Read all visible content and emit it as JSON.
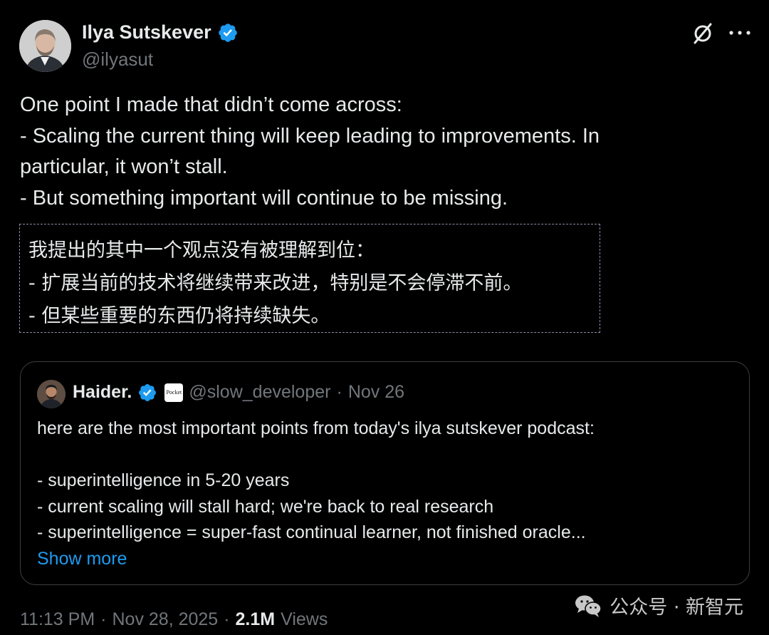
{
  "author": {
    "name": "Ilya Sutskever",
    "handle": "@ilyasut",
    "verified": true
  },
  "header_icons": {
    "grok": "grok-icon",
    "more": "more-options-icon"
  },
  "tweet": {
    "lines": [
      "One point I made that didn’t come across:",
      "- Scaling the current thing will keep leading to improvements.  In",
      "particular, it won’t stall.",
      "- But something important will continue to be missing."
    ]
  },
  "translation": {
    "lines": [
      "我提出的其中一个观点没有被理解到位：",
      "- 扩展当前的技术将继续带来改进，特别是不会停滞不前。",
      "- 但某些重要的东西仍将持续缺失。"
    ]
  },
  "quoted": {
    "name": "Haider.",
    "handle": "@slow_developer",
    "separator": "·",
    "date": "Nov 26",
    "badge_label": "Pocket",
    "lines": [
      "here are the most important points from today's ilya sutskever podcast:",
      "",
      "- superintelligence in 5-20 years",
      "- current scaling will stall hard; we're back to real research",
      "- superintelligence = super-fast continual learner, not finished oracle..."
    ],
    "show_more": "Show more"
  },
  "meta": {
    "time": "11:13 PM",
    "sep1": "·",
    "date": "Nov 28, 2025",
    "sep2": "·",
    "views_count": "2.1M",
    "views_label": "Views"
  },
  "watermark": {
    "text": "公众号 · 新智元"
  },
  "colors": {
    "background": "#000000",
    "text": "#e7e9ea",
    "muted": "#71767b",
    "link": "#1d9bf0",
    "verified": "#1d9bf0"
  }
}
